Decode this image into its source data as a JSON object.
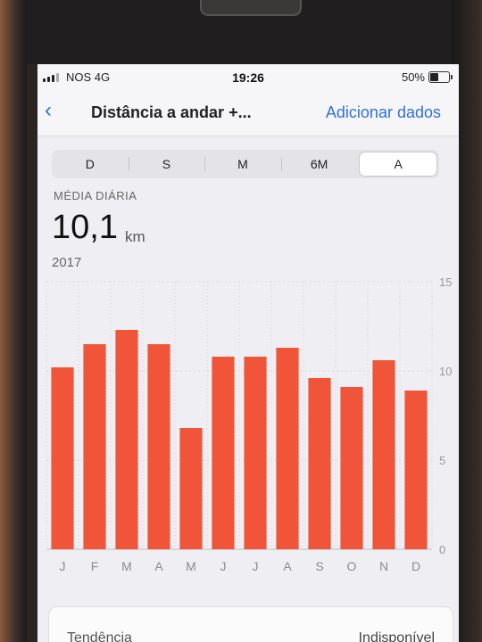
{
  "status_bar": {
    "carrier": "NOS  4G",
    "time": "19:26",
    "battery": "50%"
  },
  "nav": {
    "back_icon": "‹",
    "title": "Distância a andar +...",
    "action": "Adicionar dados"
  },
  "segments": {
    "items": [
      "D",
      "S",
      "M",
      "6M",
      "A"
    ],
    "selected": "A"
  },
  "summary": {
    "label": "MÉDIA DIÁRIA",
    "value": "10,1",
    "unit": "km",
    "period": "2017"
  },
  "colors": {
    "bar": "#f0553a",
    "accent": "#2f6fe0"
  },
  "chart_data": {
    "type": "bar",
    "categories": [
      "J",
      "F",
      "M",
      "A",
      "M",
      "J",
      "J",
      "A",
      "S",
      "O",
      "N",
      "D"
    ],
    "values": [
      10.2,
      11.5,
      12.3,
      11.5,
      6.8,
      10.8,
      10.8,
      11.3,
      9.6,
      9.1,
      10.6,
      8.9
    ],
    "ylim": [
      0,
      15
    ],
    "yticks": [
      "15",
      "10",
      "5",
      "0"
    ],
    "ytick_values": [
      15,
      10,
      5,
      0
    ],
    "grid": true
  },
  "trend": {
    "label": "Tendência",
    "value": "Indisponível"
  }
}
